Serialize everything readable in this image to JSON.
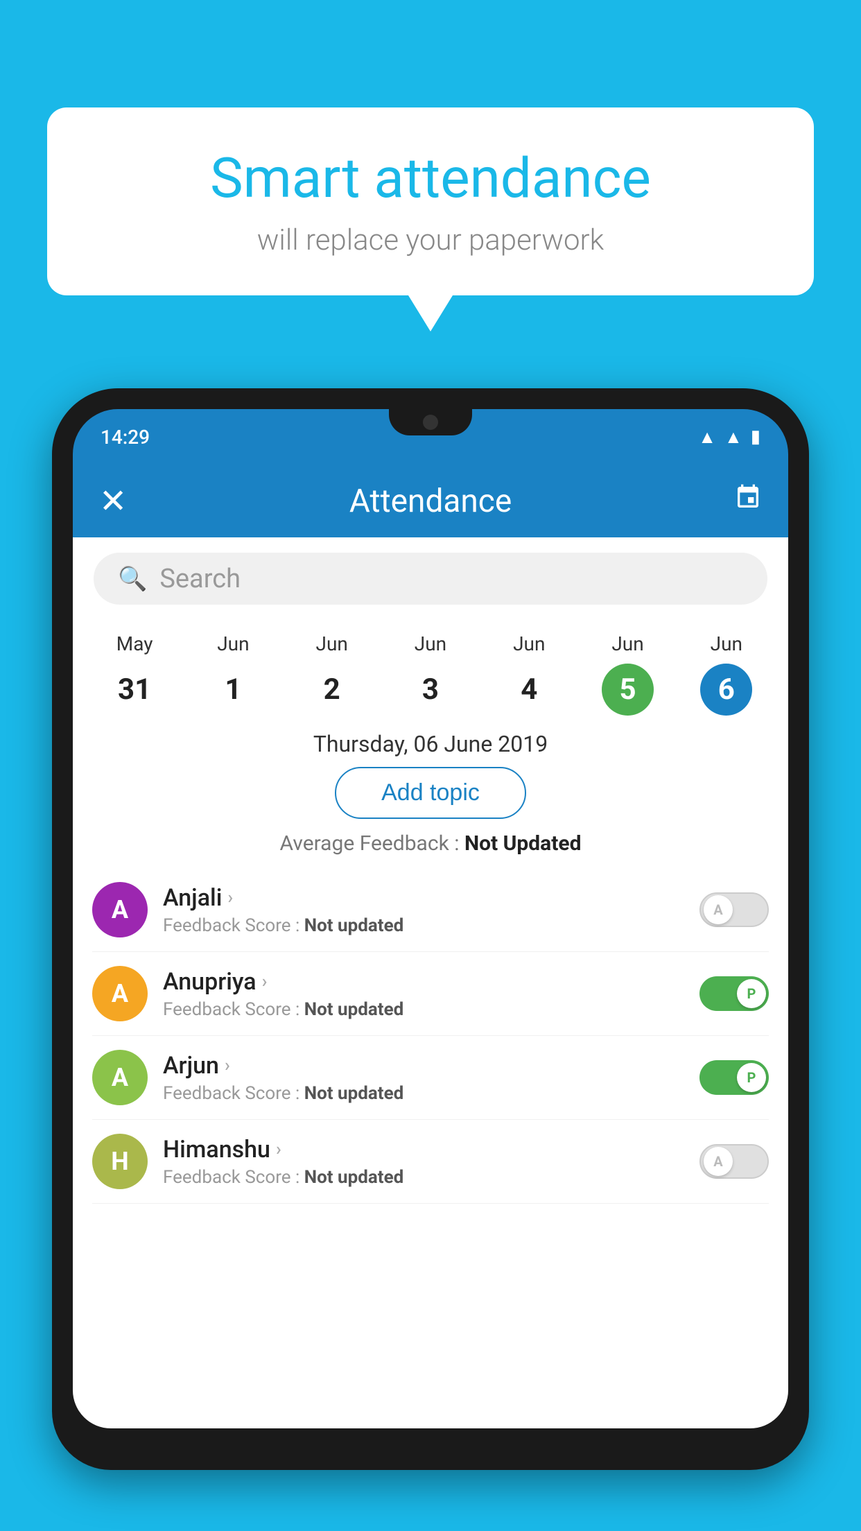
{
  "background_color": "#1ab8e8",
  "speech_bubble": {
    "title": "Smart attendance",
    "subtitle": "will replace your paperwork"
  },
  "status_bar": {
    "time": "14:29",
    "wifi": "▲",
    "signal": "▲",
    "battery": "▮"
  },
  "app_bar": {
    "close_label": "✕",
    "title": "Attendance",
    "calendar_label": "📅"
  },
  "search": {
    "placeholder": "Search"
  },
  "calendar": {
    "days": [
      {
        "month": "May",
        "date": "31",
        "state": "normal"
      },
      {
        "month": "Jun",
        "date": "1",
        "state": "normal"
      },
      {
        "month": "Jun",
        "date": "2",
        "state": "normal"
      },
      {
        "month": "Jun",
        "date": "3",
        "state": "normal"
      },
      {
        "month": "Jun",
        "date": "4",
        "state": "normal"
      },
      {
        "month": "Jun",
        "date": "5",
        "state": "today"
      },
      {
        "month": "Jun",
        "date": "6",
        "state": "selected"
      }
    ]
  },
  "selected_date_label": "Thursday, 06 June 2019",
  "add_topic_label": "Add topic",
  "avg_feedback": {
    "label": "Average Feedback : ",
    "value": "Not Updated"
  },
  "students": [
    {
      "name": "Anjali",
      "avatar_letter": "A",
      "avatar_color": "#9c27b0",
      "feedback_label": "Feedback Score : ",
      "feedback_value": "Not updated",
      "toggle": "off",
      "toggle_letter": "A"
    },
    {
      "name": "Anupriya",
      "avatar_letter": "A",
      "avatar_color": "#f5a623",
      "feedback_label": "Feedback Score : ",
      "feedback_value": "Not updated",
      "toggle": "on",
      "toggle_letter": "P"
    },
    {
      "name": "Arjun",
      "avatar_letter": "A",
      "avatar_color": "#8bc34a",
      "feedback_label": "Feedback Score : ",
      "feedback_value": "Not updated",
      "toggle": "on",
      "toggle_letter": "P"
    },
    {
      "name": "Himanshu",
      "avatar_letter": "H",
      "avatar_color": "#aab84b",
      "feedback_label": "Feedback Score : ",
      "feedback_value": "Not updated",
      "toggle": "off",
      "toggle_letter": "A"
    }
  ]
}
